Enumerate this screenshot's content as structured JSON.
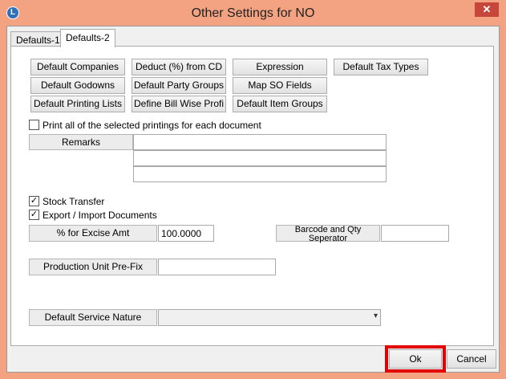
{
  "window": {
    "title": "Other Settings for NO",
    "app_icon_glyph": "L",
    "close_glyph": "✕"
  },
  "tabs": [
    {
      "label": "Defaults-1",
      "active": false
    },
    {
      "label": "Defaults-2",
      "active": true
    }
  ],
  "buttons": {
    "default_companies": "Default Companies",
    "deduct_from_cd": "Deduct (%) from CD",
    "expression": "Expression",
    "default_tax_types": "Default Tax Types",
    "default_godowns": "Default Godowns",
    "default_party_groups": "Default Party Groups",
    "map_so_fields": "Map SO Fields",
    "default_printing_lists": "Default Printing Lists",
    "define_bill_wise_profi": "Define Bill Wise Profi",
    "default_item_groups": "Default Item Groups"
  },
  "print_all": {
    "label": "Print all of the selected printings for each document",
    "checked": false
  },
  "remarks": {
    "label": "Remarks",
    "lines": [
      "",
      "",
      ""
    ]
  },
  "stock_transfer": {
    "label": "Stock Transfer",
    "checked": true
  },
  "export_import": {
    "label": "Export / Import Documents",
    "checked": true
  },
  "excise": {
    "label": "% for Excise Amt",
    "value": "100.0000"
  },
  "barcode": {
    "label_line1": "Barcode and Qty",
    "label_line2": "Seperator",
    "value": ""
  },
  "production_prefix": {
    "label": "Production Unit Pre-Fix",
    "value": ""
  },
  "service_nature": {
    "label": "Default Service Nature",
    "selected": "",
    "arrow": "▾"
  },
  "footer": {
    "ok_label": "Ok",
    "cancel_label": "Cancel"
  },
  "colors": {
    "highlight": "#e00000",
    "titlebar": "#f3a382",
    "close": "#c7463b"
  }
}
